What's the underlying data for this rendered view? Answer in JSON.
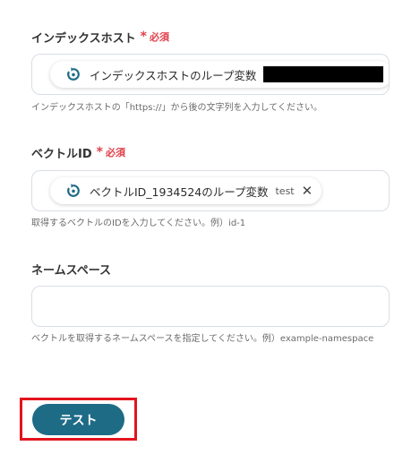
{
  "fields": [
    {
      "label": "インデックスホスト",
      "required_star": "*",
      "required_text": "必須",
      "chip": {
        "icon": "loop-icon",
        "label": "インデックスホストのループ変数",
        "value_redacted": true
      },
      "help": "インデックスホストの「https://」から後の文字列を入力してください。"
    },
    {
      "label": "ベクトルID",
      "required_star": "*",
      "required_text": "必須",
      "chip": {
        "icon": "loop-icon",
        "label": "ベクトルID_1934524のループ変数",
        "value": "test",
        "close": "✕"
      },
      "help": "取得するベクトルのIDを入力してください。例）id-1"
    },
    {
      "label": "ネームスペース",
      "value": "",
      "help": "ベクトルを取得するネームスペースを指定してください。例）example-namespace"
    }
  ],
  "test_button": {
    "label": "テスト"
  },
  "colors": {
    "accent": "#1e6b86",
    "required": "#e0404a",
    "highlight": "#e3141e",
    "chip_icon": "#1e6b86"
  }
}
